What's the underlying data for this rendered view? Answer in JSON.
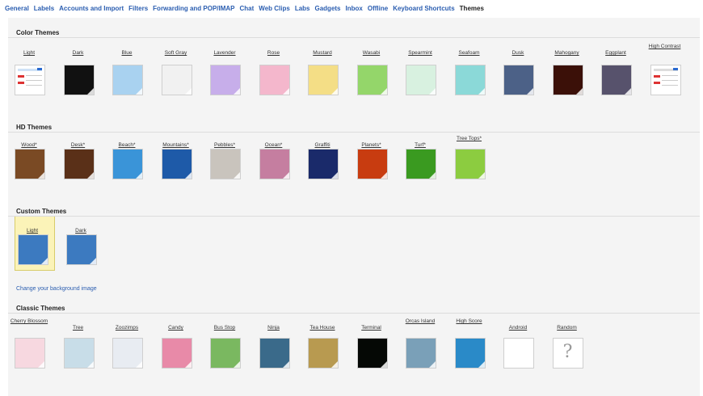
{
  "tabs": [
    "General",
    "Labels",
    "Accounts and Import",
    "Filters",
    "Forwarding and POP/IMAP",
    "Chat",
    "Web Clips",
    "Labs",
    "Gadgets",
    "Inbox",
    "Offline",
    "Keyboard Shortcuts",
    "Themes"
  ],
  "active_tab": "Themes",
  "sections": {
    "color": {
      "title": "Color Themes",
      "items": [
        {
          "label": "Light",
          "kind": "light"
        },
        {
          "label": "Dark",
          "color": "#111111"
        },
        {
          "label": "Blue",
          "color": "#a9d2f0"
        },
        {
          "label": "Soft Gray",
          "color": "#f1f1f1"
        },
        {
          "label": "Lavender",
          "color": "#c7aeea"
        },
        {
          "label": "Rose",
          "color": "#f4b7cc"
        },
        {
          "label": "Mustard",
          "color": "#f4de86"
        },
        {
          "label": "Wasabi",
          "color": "#94d66a"
        },
        {
          "label": "Spearmint",
          "color": "#d8f1e0"
        },
        {
          "label": "Seafoam",
          "color": "#8bd9d8"
        },
        {
          "label": "Dusk",
          "color": "#4c6187"
        },
        {
          "label": "Mahogany",
          "color": "#3b1008"
        },
        {
          "label": "Eggplant",
          "color": "#57526c"
        },
        {
          "label": "High Contrast",
          "kind": "contrast"
        }
      ]
    },
    "hd": {
      "title": "HD Themes",
      "items": [
        {
          "label": "Wood*",
          "color": "#7a4a24"
        },
        {
          "label": "Desk*",
          "color": "#5a3018"
        },
        {
          "label": "Beach*",
          "color": "#3a94d8"
        },
        {
          "label": "Mountains*",
          "color": "#1e5aa8"
        },
        {
          "label": "Pebbles*",
          "color": "#c9c4bd"
        },
        {
          "label": "Ocean*",
          "color": "#c57ea0"
        },
        {
          "label": "Graffiti",
          "color": "#1a2a6a"
        },
        {
          "label": "Planets*",
          "color": "#c83c10"
        },
        {
          "label": "Turf*",
          "color": "#3a9a20"
        },
        {
          "label": "Tree Tops*",
          "color": "#8ccc40"
        }
      ]
    },
    "custom": {
      "title": "Custom Themes",
      "items": [
        {
          "label": "Light",
          "color": "#3c7ac0"
        },
        {
          "label": "Dark",
          "color": "#3c7ac0"
        }
      ],
      "link": "Change your background image"
    },
    "classic": {
      "title": "Classic Themes",
      "items": [
        {
          "label": "Cherry Blossom",
          "color": "#f7d8e0"
        },
        {
          "label": "Tree",
          "color": "#c8dde8"
        },
        {
          "label": "Zoozimps",
          "color": "#e8ecf2"
        },
        {
          "label": "Candy",
          "color": "#e88aa8"
        },
        {
          "label": "Bus Stop",
          "color": "#7ab860"
        },
        {
          "label": "Ninja",
          "color": "#3a6a8a"
        },
        {
          "label": "Tea House",
          "color": "#b89a50"
        },
        {
          "label": "Terminal",
          "color": "#050805"
        },
        {
          "label": "Orcas Island",
          "color": "#7aa0b8"
        },
        {
          "label": "High Score",
          "color": "#2a8ac8"
        },
        {
          "label": "Android",
          "color": "#ffffff"
        },
        {
          "label": "Random",
          "kind": "random",
          "glyph": "?"
        }
      ]
    }
  }
}
